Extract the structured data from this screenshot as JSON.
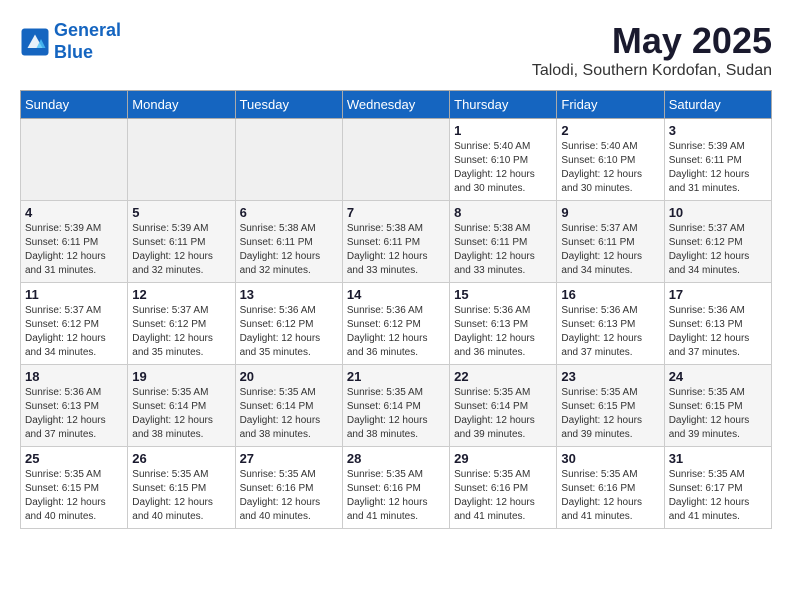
{
  "logo": {
    "line1": "General",
    "line2": "Blue"
  },
  "title": {
    "month_year": "May 2025",
    "location": "Talodi, Southern Kordofan, Sudan"
  },
  "headers": [
    "Sunday",
    "Monday",
    "Tuesday",
    "Wednesday",
    "Thursday",
    "Friday",
    "Saturday"
  ],
  "weeks": [
    [
      {
        "day": "",
        "info": ""
      },
      {
        "day": "",
        "info": ""
      },
      {
        "day": "",
        "info": ""
      },
      {
        "day": "",
        "info": ""
      },
      {
        "day": "1",
        "info": "Sunrise: 5:40 AM\nSunset: 6:10 PM\nDaylight: 12 hours\nand 30 minutes."
      },
      {
        "day": "2",
        "info": "Sunrise: 5:40 AM\nSunset: 6:10 PM\nDaylight: 12 hours\nand 30 minutes."
      },
      {
        "day": "3",
        "info": "Sunrise: 5:39 AM\nSunset: 6:11 PM\nDaylight: 12 hours\nand 31 minutes."
      }
    ],
    [
      {
        "day": "4",
        "info": "Sunrise: 5:39 AM\nSunset: 6:11 PM\nDaylight: 12 hours\nand 31 minutes."
      },
      {
        "day": "5",
        "info": "Sunrise: 5:39 AM\nSunset: 6:11 PM\nDaylight: 12 hours\nand 32 minutes."
      },
      {
        "day": "6",
        "info": "Sunrise: 5:38 AM\nSunset: 6:11 PM\nDaylight: 12 hours\nand 32 minutes."
      },
      {
        "day": "7",
        "info": "Sunrise: 5:38 AM\nSunset: 6:11 PM\nDaylight: 12 hours\nand 33 minutes."
      },
      {
        "day": "8",
        "info": "Sunrise: 5:38 AM\nSunset: 6:11 PM\nDaylight: 12 hours\nand 33 minutes."
      },
      {
        "day": "9",
        "info": "Sunrise: 5:37 AM\nSunset: 6:11 PM\nDaylight: 12 hours\nand 34 minutes."
      },
      {
        "day": "10",
        "info": "Sunrise: 5:37 AM\nSunset: 6:12 PM\nDaylight: 12 hours\nand 34 minutes."
      }
    ],
    [
      {
        "day": "11",
        "info": "Sunrise: 5:37 AM\nSunset: 6:12 PM\nDaylight: 12 hours\nand 34 minutes."
      },
      {
        "day": "12",
        "info": "Sunrise: 5:37 AM\nSunset: 6:12 PM\nDaylight: 12 hours\nand 35 minutes."
      },
      {
        "day": "13",
        "info": "Sunrise: 5:36 AM\nSunset: 6:12 PM\nDaylight: 12 hours\nand 35 minutes."
      },
      {
        "day": "14",
        "info": "Sunrise: 5:36 AM\nSunset: 6:12 PM\nDaylight: 12 hours\nand 36 minutes."
      },
      {
        "day": "15",
        "info": "Sunrise: 5:36 AM\nSunset: 6:13 PM\nDaylight: 12 hours\nand 36 minutes."
      },
      {
        "day": "16",
        "info": "Sunrise: 5:36 AM\nSunset: 6:13 PM\nDaylight: 12 hours\nand 37 minutes."
      },
      {
        "day": "17",
        "info": "Sunrise: 5:36 AM\nSunset: 6:13 PM\nDaylight: 12 hours\nand 37 minutes."
      }
    ],
    [
      {
        "day": "18",
        "info": "Sunrise: 5:36 AM\nSunset: 6:13 PM\nDaylight: 12 hours\nand 37 minutes."
      },
      {
        "day": "19",
        "info": "Sunrise: 5:35 AM\nSunset: 6:14 PM\nDaylight: 12 hours\nand 38 minutes."
      },
      {
        "day": "20",
        "info": "Sunrise: 5:35 AM\nSunset: 6:14 PM\nDaylight: 12 hours\nand 38 minutes."
      },
      {
        "day": "21",
        "info": "Sunrise: 5:35 AM\nSunset: 6:14 PM\nDaylight: 12 hours\nand 38 minutes."
      },
      {
        "day": "22",
        "info": "Sunrise: 5:35 AM\nSunset: 6:14 PM\nDaylight: 12 hours\nand 39 minutes."
      },
      {
        "day": "23",
        "info": "Sunrise: 5:35 AM\nSunset: 6:15 PM\nDaylight: 12 hours\nand 39 minutes."
      },
      {
        "day": "24",
        "info": "Sunrise: 5:35 AM\nSunset: 6:15 PM\nDaylight: 12 hours\nand 39 minutes."
      }
    ],
    [
      {
        "day": "25",
        "info": "Sunrise: 5:35 AM\nSunset: 6:15 PM\nDaylight: 12 hours\nand 40 minutes."
      },
      {
        "day": "26",
        "info": "Sunrise: 5:35 AM\nSunset: 6:15 PM\nDaylight: 12 hours\nand 40 minutes."
      },
      {
        "day": "27",
        "info": "Sunrise: 5:35 AM\nSunset: 6:16 PM\nDaylight: 12 hours\nand 40 minutes."
      },
      {
        "day": "28",
        "info": "Sunrise: 5:35 AM\nSunset: 6:16 PM\nDaylight: 12 hours\nand 41 minutes."
      },
      {
        "day": "29",
        "info": "Sunrise: 5:35 AM\nSunset: 6:16 PM\nDaylight: 12 hours\nand 41 minutes."
      },
      {
        "day": "30",
        "info": "Sunrise: 5:35 AM\nSunset: 6:16 PM\nDaylight: 12 hours\nand 41 minutes."
      },
      {
        "day": "31",
        "info": "Sunrise: 5:35 AM\nSunset: 6:17 PM\nDaylight: 12 hours\nand 41 minutes."
      }
    ]
  ]
}
